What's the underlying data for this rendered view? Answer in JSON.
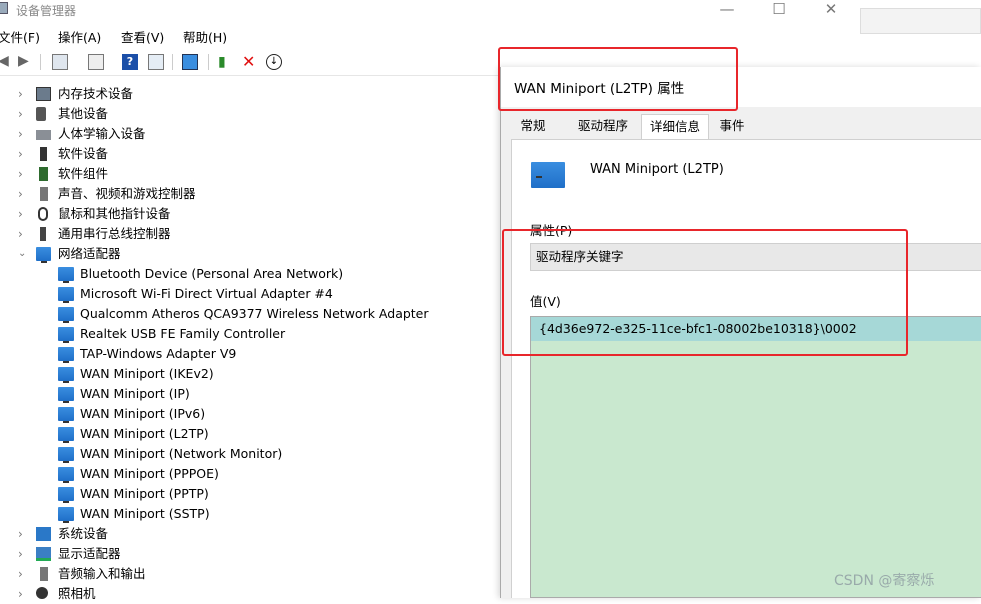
{
  "window": {
    "title": "设备管理器",
    "min": "—",
    "max": "☐",
    "close": "✕"
  },
  "menu": [
    "文件(F)",
    "操作(A)",
    "查看(V)",
    "帮助(H)"
  ],
  "tree": {
    "categories_top": [
      {
        "label": "内存技术设备"
      },
      {
        "label": "其他设备"
      },
      {
        "label": "人体学输入设备"
      },
      {
        "label": "软件设备"
      },
      {
        "label": "软件组件"
      },
      {
        "label": "声音、视频和游戏控制器"
      },
      {
        "label": "鼠标和其他指针设备"
      },
      {
        "label": "通用串行总线控制器"
      }
    ],
    "expanded_category": "网络适配器",
    "network_devices": [
      "Bluetooth Device (Personal Area Network)",
      "Microsoft Wi-Fi Direct Virtual Adapter #4",
      "Qualcomm Atheros QCA9377 Wireless Network Adapter",
      "Realtek USB FE Family Controller",
      "TAP-Windows Adapter V9",
      "WAN Miniport (IKEv2)",
      "WAN Miniport (IP)",
      "WAN Miniport (IPv6)",
      "WAN Miniport (L2TP)",
      "WAN Miniport (Network Monitor)",
      "WAN Miniport (PPPOE)",
      "WAN Miniport (PPTP)",
      "WAN Miniport (SSTP)"
    ],
    "categories_bottom": [
      {
        "label": "系统设备"
      },
      {
        "label": "显示适配器"
      },
      {
        "label": "音频输入和输出"
      },
      {
        "label": "照相机"
      }
    ]
  },
  "dialog": {
    "title": "WAN Miniport (L2TP) 属性",
    "tabs": [
      "常规",
      "驱动程序",
      "详细信息",
      "事件"
    ],
    "active_tab": "详细信息",
    "device_name": "WAN Miniport (L2TP)",
    "property_label": "属性(P)",
    "property_value": "驱动程序关键字",
    "value_label": "值(V)",
    "value_text": "{4d36e972-e325-11ce-bfc1-08002be10318}\\0002"
  },
  "watermark": "CSDN @寄察烁",
  "colors": {
    "annotation": "#e8262b",
    "value_bg": "#c9e8cf",
    "selected_row": "#a6d8d7"
  }
}
